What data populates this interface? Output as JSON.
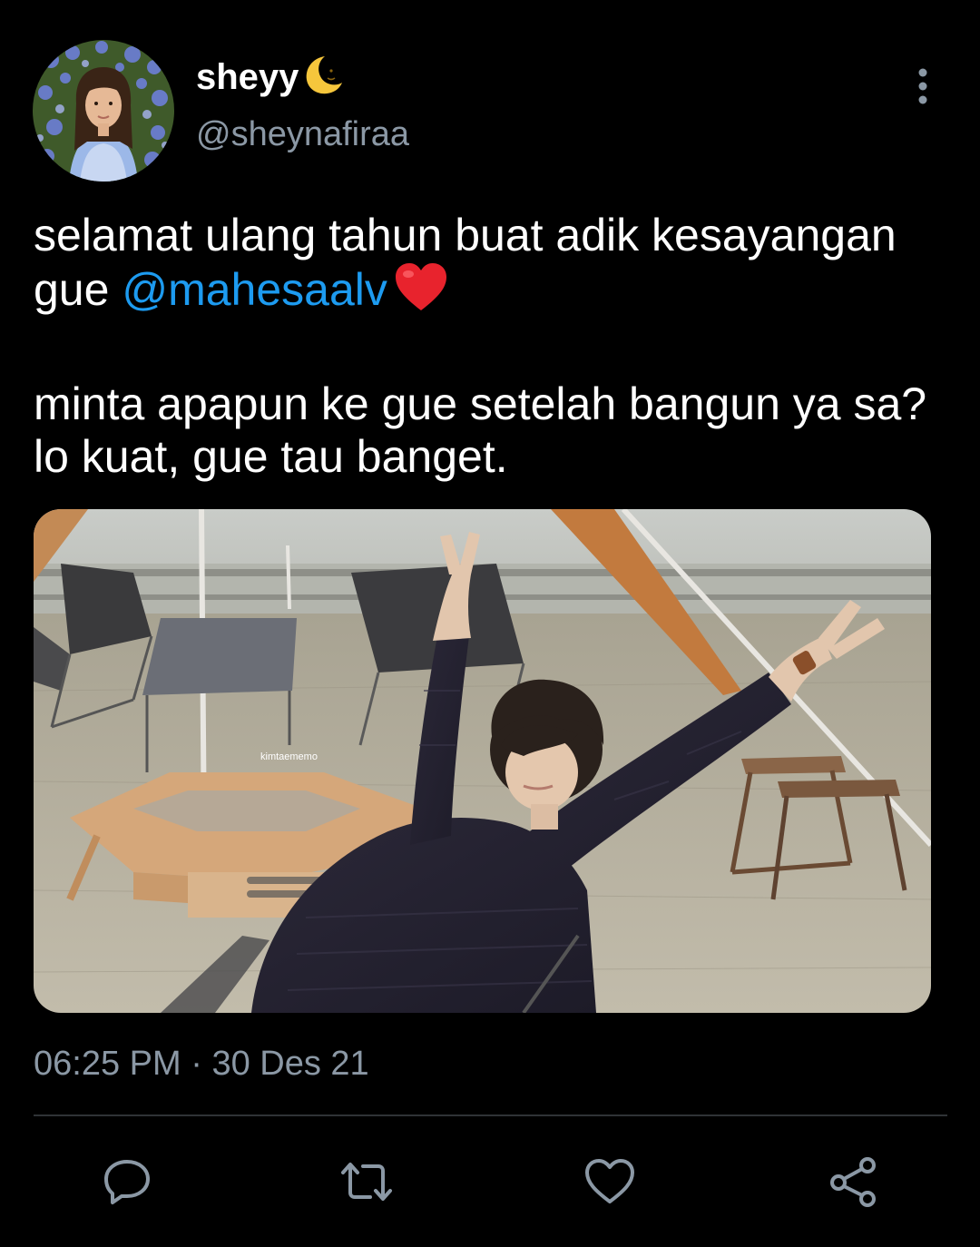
{
  "header": {
    "display_name": "sheyy",
    "handle": "@sheynafiraa",
    "name_emoji_icon": "crescent-moon-icon",
    "menu_icon": "more-vertical-icon"
  },
  "tweet": {
    "line1_text": "selamat ulang tahun buat adik kesayangan gue ",
    "mention": "@mahesaalv",
    "heart_icon": "red-heart-emoji-icon",
    "paragraph2": "minta apapun ke gue setelah bangun ya sa? lo kuat, gue tau banget.",
    "image_watermark": "kimtaememo"
  },
  "meta": {
    "time": "06:25 PM",
    "separator": "·",
    "date": "30 Des 21"
  },
  "actions": [
    {
      "icon": "reply-icon"
    },
    {
      "icon": "retweet-icon"
    },
    {
      "icon": "like-icon"
    },
    {
      "icon": "share-icon"
    }
  ],
  "colors": {
    "background": "#000000",
    "text": "#ffffff",
    "secondary_text": "#8b98a5",
    "link": "#1d9bf0",
    "divider": "#2f3336",
    "heart": "#e8232d"
  }
}
